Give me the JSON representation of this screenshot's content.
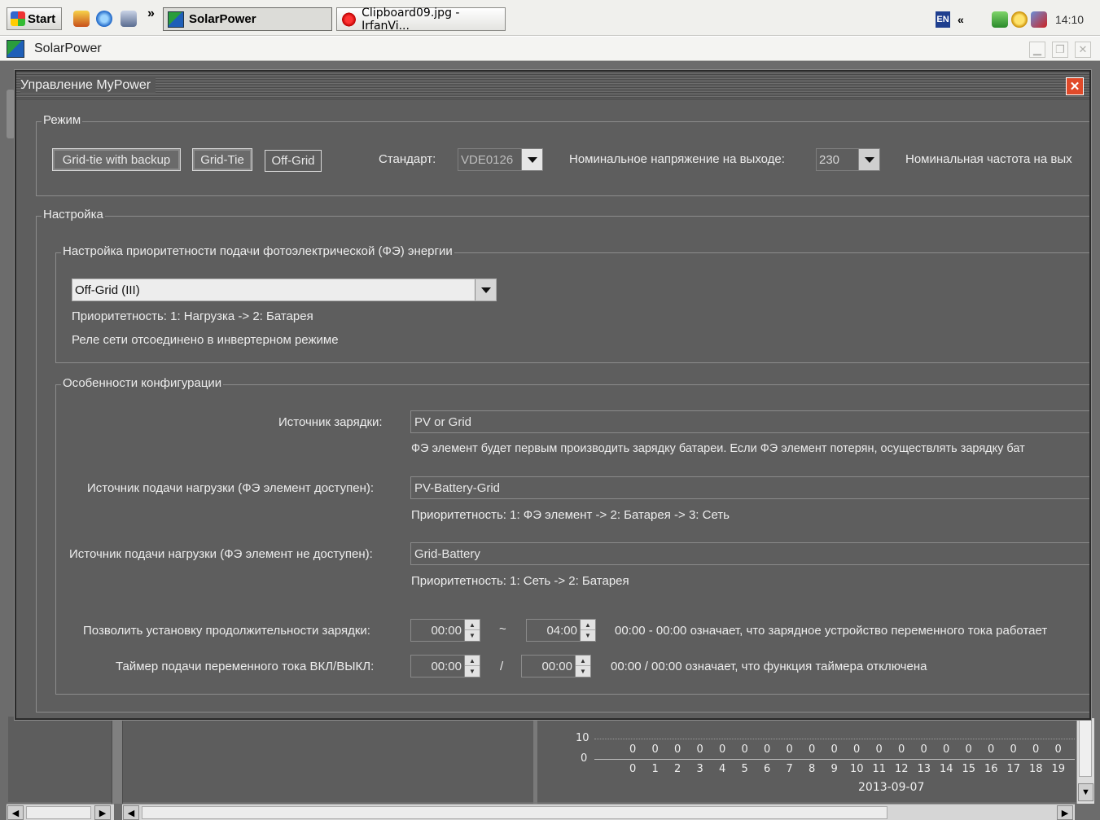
{
  "taskbar": {
    "start_label": "Start",
    "tasks": [
      {
        "label": "SolarPower",
        "icon": "solarpower-icon"
      },
      {
        "label": "Clipboard09.jpg - IrfanVi...",
        "icon": "irfanview-icon"
      }
    ],
    "quicklaunch_more": "»",
    "lang": "EN",
    "tray_expand": "«",
    "clock": "14:10"
  },
  "app": {
    "title": "SolarPower"
  },
  "dialog": {
    "title": "Управление MyPower",
    "mode": {
      "legend": "Режим",
      "buttons": [
        "Grid-tie with backup",
        "Grid-Tie",
        "Off-Grid"
      ],
      "standard_label": "Стандарт:",
      "standard_value": "VDE0126",
      "voltage_label": "Номинальное напряжение на выходе:",
      "voltage_value": "230",
      "frequency_label": "Номинальная частота на вых"
    },
    "settings": {
      "legend": "Настройка",
      "priority": {
        "legend": "Настройка приоритетности подачи фотоэлектрической (ФЭ) энергии",
        "selected": "Off-Grid (III)",
        "line1": "Приоритетность: 1: Нагрузка -> 2: Батарея",
        "line2": "Реле сети отсоединено в инвертерном режиме"
      },
      "config": {
        "legend": "Особенности конфигурации",
        "charge_source_label": "Источник зарядки:",
        "charge_source_value": "PV or Grid",
        "charge_source_note": "ФЭ элемент будет первым производить зарядку батареи. Если ФЭ элемент потерян, осуществлять зарядку бат",
        "load_pv_label": "Источник подачи нагрузки (ФЭ элемент доступен):",
        "load_pv_value": "PV-Battery-Grid",
        "load_pv_note": "Приоритетность: 1: ФЭ элемент -> 2: Батарея -> 3: Сеть",
        "load_nopv_label": "Источник подачи нагрузки (ФЭ элемент не доступен):",
        "load_nopv_value": "Grid-Battery",
        "load_nopv_note": "Приоритетность: 1: Сеть -> 2: Батарея",
        "charge_time_label": "Позволить установку продолжительности зарядки:",
        "charge_time_from": "00:00",
        "charge_time_sep": "~",
        "charge_time_to": "04:00",
        "charge_time_note": "00:00 - 00:00 означает, что зарядное устройство переменного тока работает",
        "ac_timer_label": "Таймер подачи переменного тока ВКЛ/ВЫКЛ:",
        "ac_timer_on": "00:00",
        "ac_timer_sep": "/",
        "ac_timer_off": "00:00",
        "ac_timer_note": "00:00 / 00:00 означает, что функция таймера отключена"
      }
    }
  },
  "background_chart": {
    "y_ticks": [
      "10",
      "0"
    ],
    "x_ticks": [
      "0",
      "1",
      "2",
      "3",
      "4",
      "5",
      "6",
      "7",
      "8",
      "9",
      "10",
      "11",
      "12",
      "13",
      "14",
      "15",
      "16",
      "17",
      "18",
      "19"
    ],
    "values": [
      "0",
      "0",
      "0",
      "0",
      "0",
      "0",
      "0",
      "0",
      "0",
      "0",
      "0",
      "0",
      "0",
      "0",
      "0",
      "0",
      "0",
      "0",
      "0",
      "0"
    ],
    "date": "2013-09-07"
  }
}
